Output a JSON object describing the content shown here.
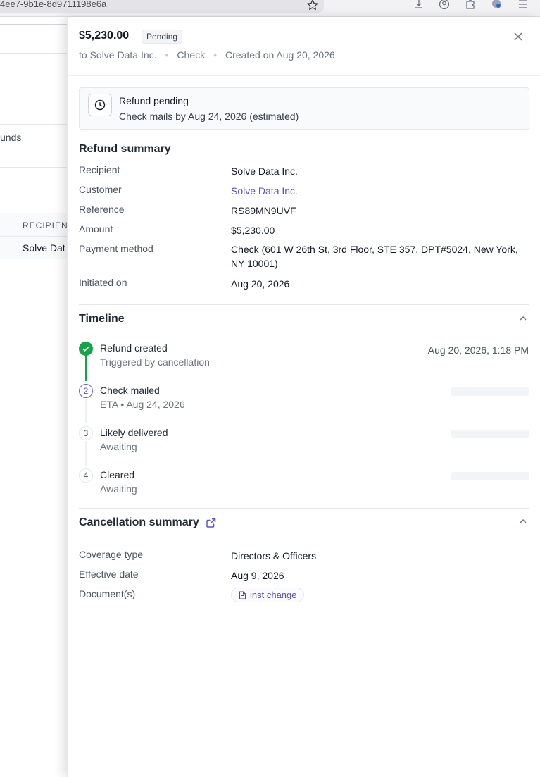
{
  "browser": {
    "url_fragment": "4ee7-9b1e-8d9711198e6a"
  },
  "background": {
    "partial_label": "unds",
    "column_header": "RECIPIEN",
    "row_cell": "Solve Dat"
  },
  "header": {
    "amount": "$5,230.00",
    "status": "Pending",
    "recipient_line": "to Solve Data Inc.",
    "method": "Check",
    "created": "Created on Aug 20, 2026"
  },
  "alert": {
    "title": "Refund pending",
    "subtitle": "Check mails by Aug 24, 2026 (estimated)"
  },
  "refund_summary": {
    "title": "Refund summary",
    "rows": [
      {
        "label": "Recipient",
        "value": "Solve Data Inc."
      },
      {
        "label": "Customer",
        "value": "Solve Data Inc."
      },
      {
        "label": "Reference",
        "value": "RS89MN9UVF"
      },
      {
        "label": "Amount",
        "value": "$5,230.00"
      },
      {
        "label": "Payment method",
        "value": "Check (601 W 26th St, 3rd Floor, STE 357, DPT#5024, New York, NY 10001)"
      },
      {
        "label": "Initiated on",
        "value": "Aug 20, 2026"
      }
    ]
  },
  "timeline": {
    "title": "Timeline",
    "steps": [
      {
        "number": "",
        "title": "Refund created",
        "subtitle": "Triggered by cancellation",
        "date": "Aug 20, 2026, 1:18 PM",
        "state": "done"
      },
      {
        "number": "2",
        "title": "Check mailed",
        "subtitle": "ETA • Aug 24, 2026",
        "date": "",
        "state": "active"
      },
      {
        "number": "3",
        "title": "Likely delivered",
        "subtitle": "Awaiting",
        "date": "",
        "state": "pending"
      },
      {
        "number": "4",
        "title": "Cleared",
        "subtitle": "Awaiting",
        "date": "",
        "state": "pending"
      }
    ]
  },
  "cancellation": {
    "title": "Cancellation summary",
    "rows": [
      {
        "label": "Coverage type",
        "value": "Directors & Officers"
      },
      {
        "label": "Effective date",
        "value": "Aug 9, 2026"
      },
      {
        "label": "Document(s)",
        "value": "inst change"
      }
    ]
  },
  "colors": {
    "link": "#5b4fd6",
    "success": "#16a34a",
    "muted": "#6b7280"
  }
}
